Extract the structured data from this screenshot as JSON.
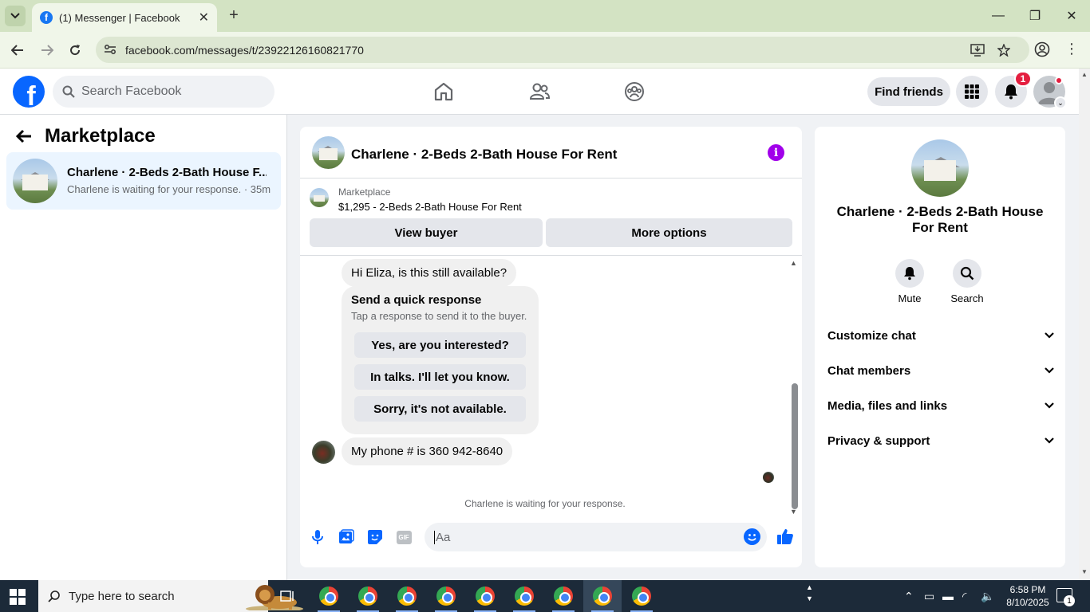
{
  "browser": {
    "tab_title": "(1) Messenger | Facebook",
    "favicon_letter": "f",
    "url": "facebook.com/messages/t/23922126160821770"
  },
  "fb": {
    "logo_letter": "f",
    "search_placeholder": "Search Facebook",
    "find_friends": "Find friends",
    "notification_count": "1",
    "brand_color": "#0866ff"
  },
  "left": {
    "title": "Marketplace",
    "conversation": {
      "name": "Charlene · 2-Beds 2-Bath House F...",
      "subtitle": "Charlene is waiting for your response. · 35m"
    }
  },
  "chat": {
    "title": "Charlene · 2-Beds 2-Bath House For Rent",
    "listing_source": "Marketplace",
    "listing_price": "$1,295 - 2-Beds 2-Bath House For Rent",
    "view_buyer": "View buyer",
    "more_options": "More options",
    "messages": [
      {
        "text": "Hi Eliza, is this still available?"
      },
      {
        "text": "My phone # is 360 942-8640"
      }
    ],
    "quick_response": {
      "title": "Send a quick response",
      "subtitle": "Tap a response to send it to the buyer.",
      "options": [
        "Yes, are you interested?",
        "In talks. I'll let you know.",
        "Sorry, it's not available."
      ]
    },
    "waiting_note": "Charlene is waiting for your response.",
    "composer_placeholder": "Aa",
    "gif_label": "GIF"
  },
  "right": {
    "title": "Charlene · 2-Beds 2-Bath House For Rent",
    "mute": "Mute",
    "search": "Search",
    "sections": [
      "Customize chat",
      "Chat members",
      "Media, files and links",
      "Privacy & support"
    ]
  },
  "taskbar": {
    "search_placeholder": "Type here to search",
    "time": "6:58 PM",
    "date": "8/10/2025",
    "notification_count": "1"
  }
}
